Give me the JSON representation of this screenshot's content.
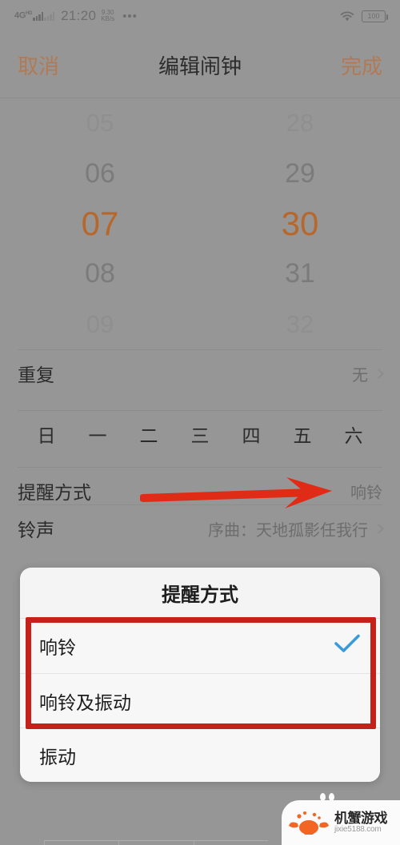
{
  "statusbar": {
    "network": "4G",
    "network_sup": "HD",
    "time": "21:20",
    "speed_value": "9.30",
    "speed_unit": "KB/s",
    "overflow": "•••",
    "wifi_icon": "wifi-icon",
    "battery": "100"
  },
  "navbar": {
    "cancel": "取消",
    "title": "编辑闹钟",
    "done": "完成",
    "accent_color": "#b07a55"
  },
  "picker": {
    "hours": [
      "05",
      "06",
      "07",
      "08",
      "09"
    ],
    "minutes": [
      "28",
      "29",
      "30",
      "31",
      "32"
    ],
    "selected_hour": "07",
    "selected_minute": "30",
    "selected_color": "#b8672b"
  },
  "rows": {
    "repeat": {
      "label": "重复",
      "value": "无"
    },
    "weekdays": [
      "日",
      "一",
      "二",
      "三",
      "四",
      "五",
      "六"
    ],
    "reminder": {
      "label": "提醒方式",
      "value": "响铃"
    },
    "ringtone": {
      "label": "铃声",
      "value": "序曲：天地孤影任我行"
    }
  },
  "dialog": {
    "title": "提醒方式",
    "options": [
      {
        "label": "响铃",
        "checked": true
      },
      {
        "label": "响铃及振动",
        "checked": false
      },
      {
        "label": "振动",
        "checked": false
      }
    ],
    "check_color": "#3a9bd9"
  },
  "annotations": {
    "color": "#c4211b",
    "arrow_name": "red-arrow-to-reminder-value",
    "box_name": "red-highlight-box-options"
  },
  "watermark": {
    "name": "机蟹游戏",
    "url": "jixie5188.com",
    "logo_color": "#f26522"
  }
}
